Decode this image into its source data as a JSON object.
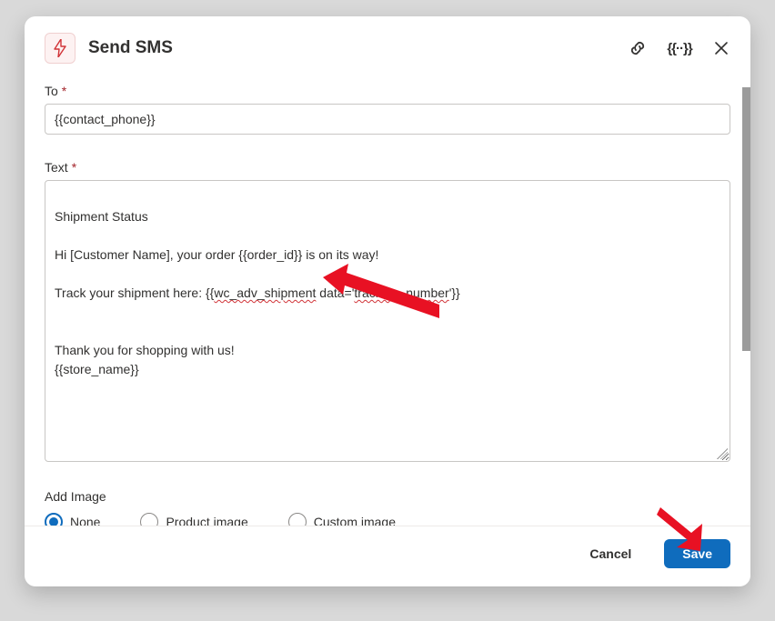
{
  "header": {
    "title": "Send SMS"
  },
  "fields": {
    "to_label": "To",
    "to_value": "{{contact_phone}}",
    "text_label": "Text",
    "text_line1": "Shipment Status",
    "text_line2_pre": "Hi [Customer Name], your order {{order_id}} is on its way!",
    "text_line3_pre": "Track your shipment here: {{",
    "text_line3_wavy1": "wc_adv_shipment",
    "text_line3_mid": " data='",
    "text_line3_wavy2": "tracking_number",
    "text_line3_post": "'}}",
    "text_line4": "Thank you for shopping with us!",
    "text_line5": "{{store_name}}"
  },
  "image_section": {
    "label": "Add Image",
    "options": {
      "none": "None",
      "product": "Product image",
      "custom": "Custom image"
    }
  },
  "footer": {
    "cancel": "Cancel",
    "save": "Save"
  }
}
